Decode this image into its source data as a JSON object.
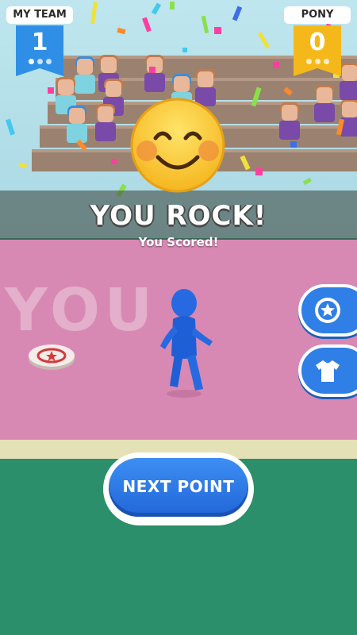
{
  "scoreboard": {
    "home": {
      "name": "MY TEAM",
      "score": "1",
      "color": "#2f8fe6",
      "points_marked": 1,
      "points_total": 3
    },
    "away": {
      "name": "PONY",
      "score": "0",
      "color": "#f5b81a",
      "points_marked": 0,
      "points_total": 3
    }
  },
  "celebration": {
    "emoji": "smiling-face-icon",
    "title": "YOU ROCK!",
    "subtitle": "You Scored!"
  },
  "field": {
    "painted_word": "YOU",
    "color": "#d889b3"
  },
  "side_buttons": [
    {
      "name": "star-button",
      "icon": "star-icon"
    },
    {
      "name": "shirt-button",
      "icon": "shirt-icon"
    }
  ],
  "actions": {
    "next_point_label": "NEXT POINT"
  },
  "colors": {
    "accent": "#2f7fe6",
    "ground": "#2a8f6a",
    "player": "#1f5fd6"
  }
}
